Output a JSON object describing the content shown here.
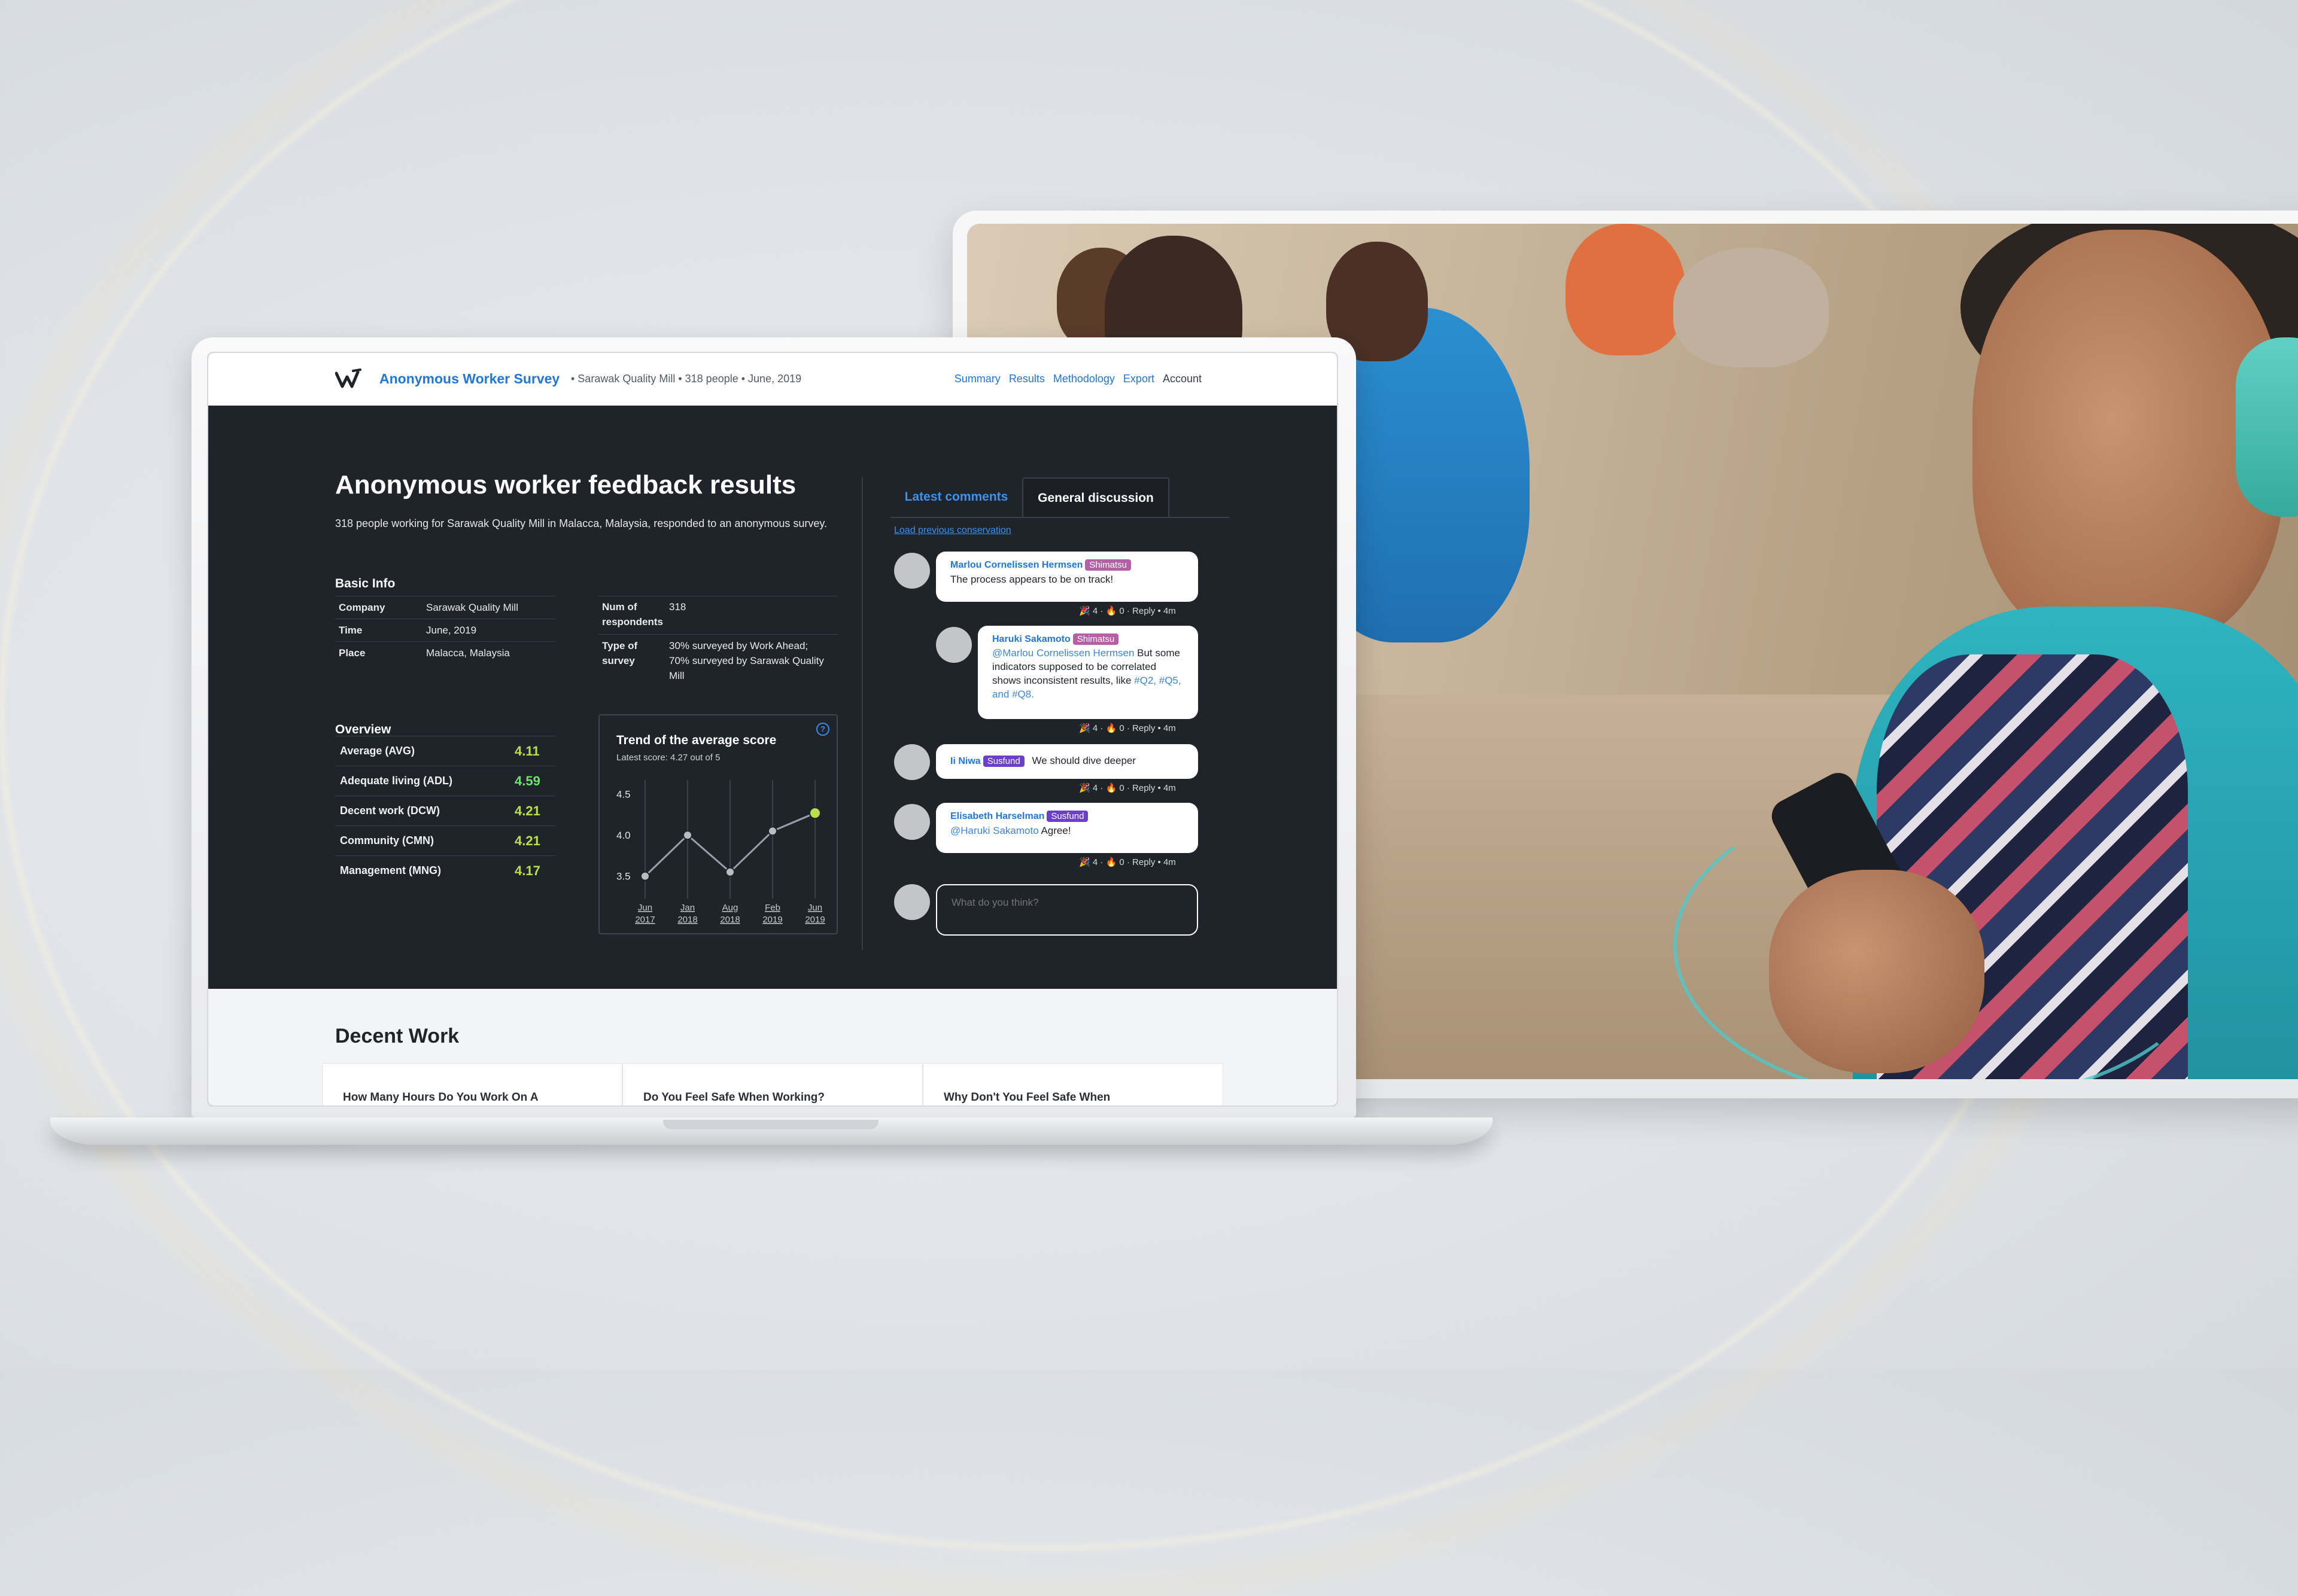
{
  "navbar": {
    "brand": "Anonymous Worker Survey",
    "subtitle": "• Sarawak Quality Mill • 318 people • June, 2019",
    "nav": [
      "Summary",
      "Results",
      "Methodology",
      "Export",
      "Account"
    ]
  },
  "page": {
    "title": "Anonymous worker feedback results",
    "intro": "318 people working for Sarawak Quality Mill in Malacca, Malaysia, responded to an anonymous survey."
  },
  "basic_info": {
    "heading": "Basic Info",
    "left": [
      {
        "k": "Company",
        "v": "Sarawak Quality Mill"
      },
      {
        "k": "Time",
        "v": "June, 2019"
      },
      {
        "k": "Place",
        "v": "Malacca, Malaysia"
      }
    ],
    "right": [
      {
        "k": "Num of respondents",
        "v": "318"
      },
      {
        "k": "Type of survey",
        "v": "30% surveyed by Work Ahead; 70% surveyed by Sarawak Quality Mill"
      }
    ]
  },
  "overview": {
    "heading": "Overview",
    "rows": [
      {
        "label": "Average (AVG)",
        "value": "4.11"
      },
      {
        "label": "Adequate living (ADL)",
        "value": "4.59"
      },
      {
        "label": "Decent work (DCW)",
        "value": "4.21"
      },
      {
        "label": "Community (CMN)",
        "value": "4.21"
      },
      {
        "label": "Management (MNG)",
        "value": "4.17"
      }
    ]
  },
  "chart_data": {
    "type": "line",
    "title": "Trend of the average score",
    "subtitle": "Latest score: 4.27 out of 5",
    "categories": [
      "Jun 2017",
      "Jan 2018",
      "Aug 2018",
      "Feb 2019",
      "Jun 2019"
    ],
    "values": [
      3.5,
      4.0,
      3.55,
      4.05,
      4.27
    ],
    "ylim": [
      3.3,
      4.6
    ],
    "yticks": [
      "4.5",
      "4.0",
      "3.5"
    ],
    "grid": "vertical",
    "colors": {
      "line": "#9aa0a8",
      "point": "#b8bdc3",
      "latest": "#b9e04a"
    }
  },
  "discussion": {
    "tabs": [
      "Latest comments",
      "General discussion"
    ],
    "load_previous": "Load previous conservation",
    "comments": [
      {
        "name": "Marlou Cornelissen Hermsen",
        "badge": "Shimatsu",
        "mention": "",
        "text": "The process appears to be on track!",
        "tags": "",
        "meta": "🎉 4 · 🔥 0 · Reply • 4m"
      },
      {
        "name": "Haruki Sakamoto",
        "badge": "Shimatsu",
        "mention": "@Marlou Cornelissen Hermsen",
        "text": "But some indicators supposed to be correlated shows inconsistent results, like",
        "tags": "#Q2, #Q5, and #Q8.",
        "meta": "🎉 4 · 🔥 0 · Reply • 4m"
      },
      {
        "name": "Ii Niwa",
        "badge": "Susfund",
        "mention": "",
        "text": "We should dive deeper",
        "tags": "",
        "meta": "🎉 4 · 🔥 0 · Reply • 4m"
      },
      {
        "name": "Elisabeth Harselman",
        "badge": "Susfund",
        "mention": "@Haruki Sakamoto",
        "text": "Agree!",
        "tags": "",
        "meta": "🎉 4 · 🔥 0 · Reply • 4m"
      }
    ],
    "input_placeholder": "What do you think?"
  },
  "decent_work": {
    "title": "Decent Work",
    "cards": [
      "How Many Hours Do You Work On A",
      "Do You Feel Safe When Working?",
      "Why Don't You Feel Safe When"
    ]
  }
}
